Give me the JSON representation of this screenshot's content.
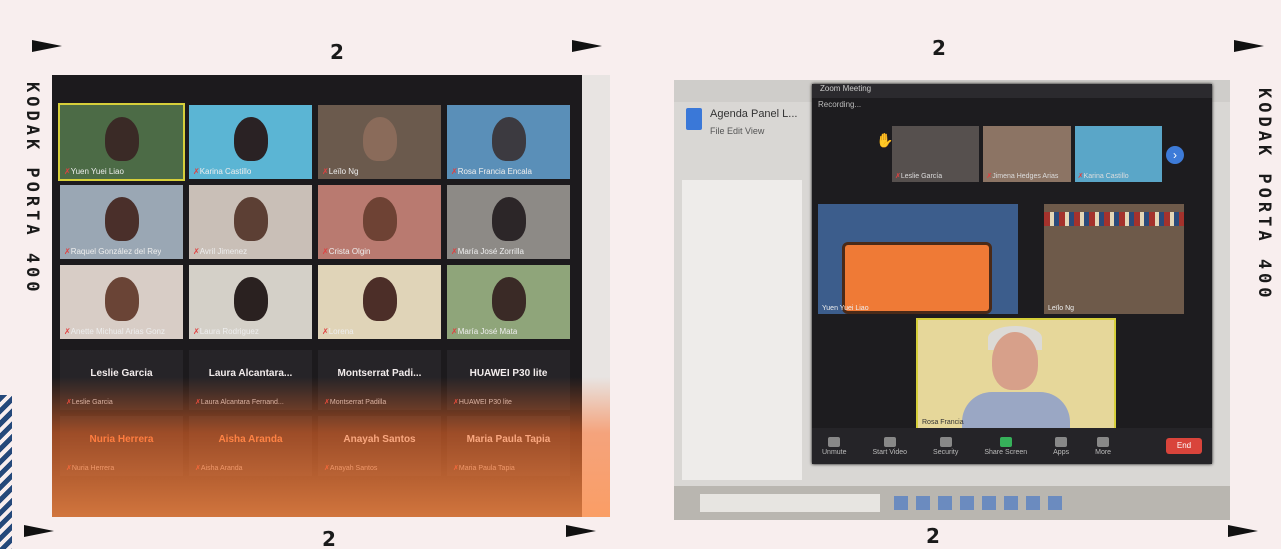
{
  "film": {
    "frame_number": "2",
    "brand_label": "KODAK PORTA 400"
  },
  "left_photo": {
    "tiles": [
      {
        "name": "Yuen Yuei Liao"
      },
      {
        "name": "Karina Castillo"
      },
      {
        "name": "Leïlo Ng"
      },
      {
        "name": "Rosa Francia Encala"
      },
      {
        "name": "Raquel González del Rey"
      },
      {
        "name": "Avril Jimenez"
      },
      {
        "name": "Crista Olgin"
      },
      {
        "name": "María José Zorrilla"
      },
      {
        "name": "Anette Michual Arias Gonz"
      },
      {
        "name": "Laura Rodriguez"
      },
      {
        "name": "Lorena"
      },
      {
        "name": "María José Mata"
      }
    ],
    "blank_tiles": [
      {
        "display": "Leslie Garcia",
        "small": "Leslie Garcia"
      },
      {
        "display": "Laura Alcantara...",
        "small": "Laura Alcantara Fernand..."
      },
      {
        "display": "Montserrat Padi...",
        "small": "Montserrat Padilla"
      },
      {
        "display": "HUAWEI P30 lite",
        "small": "HUAWEI P30 lite"
      },
      {
        "display": "Nuria Herrera",
        "small": "Nuria Herrera"
      },
      {
        "display": "Aisha Aranda",
        "small": "Aisha Aranda"
      },
      {
        "display": "Anayah Santos",
        "small": "Anayah Santos"
      },
      {
        "display": "Maria Paula Tapia",
        "small": "Maria Paula Tapia"
      }
    ]
  },
  "right_photo": {
    "window_title": "Zoom Meeting",
    "recording_label": "Recording...",
    "doc_title": "Agenda Panel L...",
    "doc_menu": "File  Edit  View",
    "strip": [
      {
        "name": "Leslie García"
      },
      {
        "name": "Jimena Hedges Arias"
      },
      {
        "name": "Karina Castillo"
      }
    ],
    "speakers": {
      "a": "Yuen Yuei Liao",
      "b": "Leïlo Ng",
      "c": "Rosa Francia"
    },
    "toolbar": [
      "Unmute",
      "Start Video",
      "Security",
      "Share Screen",
      "Apps",
      "More"
    ],
    "end_label": "End"
  }
}
